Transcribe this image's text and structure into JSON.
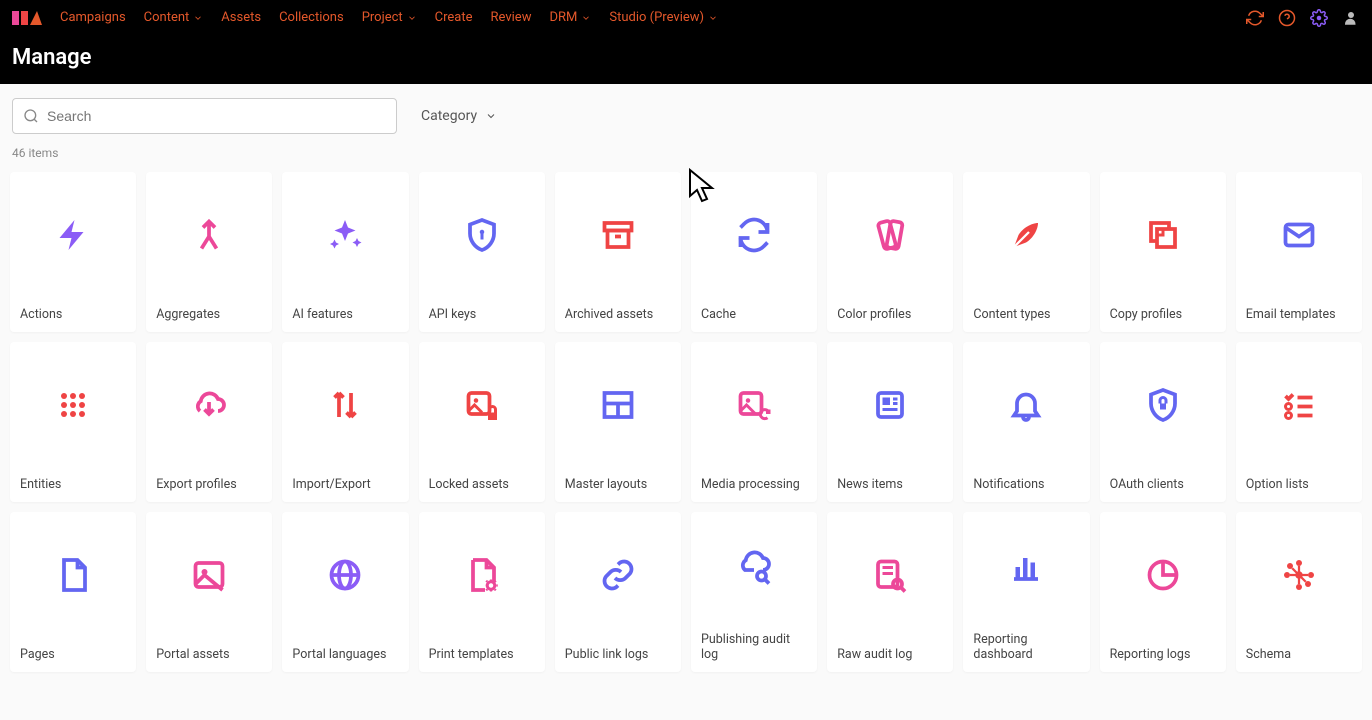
{
  "nav": {
    "items": [
      {
        "label": "Campaigns",
        "dropdown": false
      },
      {
        "label": "Content",
        "dropdown": true
      },
      {
        "label": "Assets",
        "dropdown": false
      },
      {
        "label": "Collections",
        "dropdown": false
      },
      {
        "label": "Project",
        "dropdown": true
      },
      {
        "label": "Create",
        "dropdown": false
      },
      {
        "label": "Review",
        "dropdown": false
      },
      {
        "label": "DRM",
        "dropdown": true
      },
      {
        "label": "Studio (Preview)",
        "dropdown": true
      }
    ]
  },
  "page": {
    "title": "Manage"
  },
  "search": {
    "placeholder": "Search"
  },
  "filter": {
    "label": "Category"
  },
  "count": {
    "text": "46 items"
  },
  "cards": [
    {
      "label": "Actions",
      "icon": "bolt",
      "color": "c-purple"
    },
    {
      "label": "Aggregates",
      "icon": "merge",
      "color": "c-pink"
    },
    {
      "label": "AI features",
      "icon": "sparkles",
      "color": "c-purple"
    },
    {
      "label": "API keys",
      "icon": "shield-key",
      "color": "c-blue"
    },
    {
      "label": "Archived assets",
      "icon": "archive",
      "color": "c-red"
    },
    {
      "label": "Cache",
      "icon": "refresh",
      "color": "c-blue"
    },
    {
      "label": "Color profiles",
      "icon": "swatch",
      "color": "c-pink"
    },
    {
      "label": "Content types",
      "icon": "feather",
      "color": "c-red"
    },
    {
      "label": "Copy profiles",
      "icon": "copy",
      "color": "c-red"
    },
    {
      "label": "Email templates",
      "icon": "mail",
      "color": "c-blue"
    },
    {
      "label": "Entities",
      "icon": "grid-dots",
      "color": "c-red"
    },
    {
      "label": "Export profiles",
      "icon": "cloud-down",
      "color": "c-pink"
    },
    {
      "label": "Import/Export",
      "icon": "up-down",
      "color": "c-red"
    },
    {
      "label": "Locked assets",
      "icon": "image-lock",
      "color": "c-red"
    },
    {
      "label": "Master layouts",
      "icon": "layout",
      "color": "c-blue"
    },
    {
      "label": "Media processing",
      "icon": "image-refresh",
      "color": "c-pink"
    },
    {
      "label": "News items",
      "icon": "news",
      "color": "c-blue"
    },
    {
      "label": "Notifications",
      "icon": "bell",
      "color": "c-blue"
    },
    {
      "label": "OAuth clients",
      "icon": "shield-lock",
      "color": "c-blue"
    },
    {
      "label": "Option lists",
      "icon": "checklist",
      "color": "c-red"
    },
    {
      "label": "Pages",
      "icon": "page",
      "color": "c-blue"
    },
    {
      "label": "Portal assets",
      "icon": "image",
      "color": "c-pink"
    },
    {
      "label": "Portal languages",
      "icon": "globe",
      "color": "c-purple"
    },
    {
      "label": "Print templates",
      "icon": "page-cog",
      "color": "c-pink"
    },
    {
      "label": "Public link logs",
      "icon": "link",
      "color": "c-blue"
    },
    {
      "label": "Publishing audit log",
      "icon": "cloud-search",
      "color": "c-blue"
    },
    {
      "label": "Raw audit log",
      "icon": "doc-search",
      "color": "c-pink"
    },
    {
      "label": "Reporting dashboard",
      "icon": "chart",
      "color": "c-blue"
    },
    {
      "label": "Reporting logs",
      "icon": "pie",
      "color": "c-pink"
    },
    {
      "label": "Schema",
      "icon": "network",
      "color": "c-red"
    }
  ]
}
